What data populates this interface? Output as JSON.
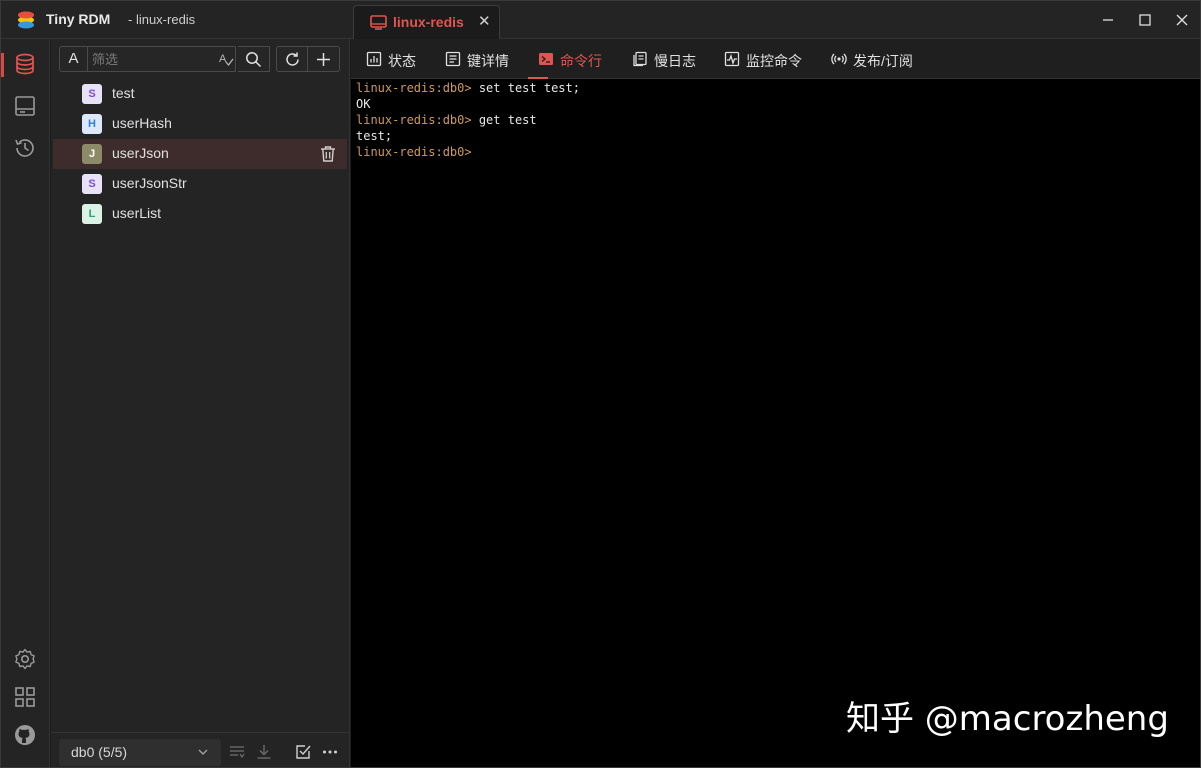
{
  "titlebar": {
    "app_name": "Tiny RDM",
    "subtitle": "- linux-redis",
    "connection_tab": {
      "label": "linux-redis",
      "close": "✕"
    }
  },
  "browser": {
    "filter_type": "A",
    "filter_placeholder": "筛选",
    "keys": [
      {
        "type": "S",
        "name": "test",
        "badge_color": "#7b4bd6",
        "badge_bg": "#e8e2f7"
      },
      {
        "type": "H",
        "name": "userHash",
        "badge_color": "#2f7fd4",
        "badge_bg": "#dde9f8"
      },
      {
        "type": "J",
        "name": "userJson",
        "badge_color": "#ffffff",
        "badge_bg": "#8c8a67"
      },
      {
        "type": "S",
        "name": "userJsonStr",
        "badge_color": "#7b4bd6",
        "badge_bg": "#e8e2f7"
      },
      {
        "type": "L",
        "name": "userList",
        "badge_color": "#27a36b",
        "badge_bg": "#dcf2e6"
      }
    ],
    "selected_key": "userJson",
    "db_select": "db0 (5/5)"
  },
  "subtabs": [
    {
      "label": "状态",
      "icon": "status-icon"
    },
    {
      "label": "键详情",
      "icon": "key-detail-icon"
    },
    {
      "label": "命令行",
      "icon": "terminal-icon",
      "active": true
    },
    {
      "label": "慢日志",
      "icon": "slow-log-icon"
    },
    {
      "label": "监控命令",
      "icon": "monitor-icon"
    },
    {
      "label": "发布/订阅",
      "icon": "pubsub-icon"
    }
  ],
  "terminal": {
    "lines": [
      {
        "prompt": "linux-redis:db0> ",
        "text": "set test test;"
      },
      {
        "prompt": "",
        "text": "OK"
      },
      {
        "prompt": "linux-redis:db0> ",
        "text": "get test"
      },
      {
        "prompt": "",
        "text": "test;"
      },
      {
        "prompt": "linux-redis:db0> ",
        "text": ""
      }
    ]
  },
  "watermark": "知乎 @macrozheng",
  "colors": {
    "accent": "#e0554f",
    "prompt": "#cf9a5a",
    "background": "#1b1b1b",
    "terminal_bg": "#000000"
  }
}
